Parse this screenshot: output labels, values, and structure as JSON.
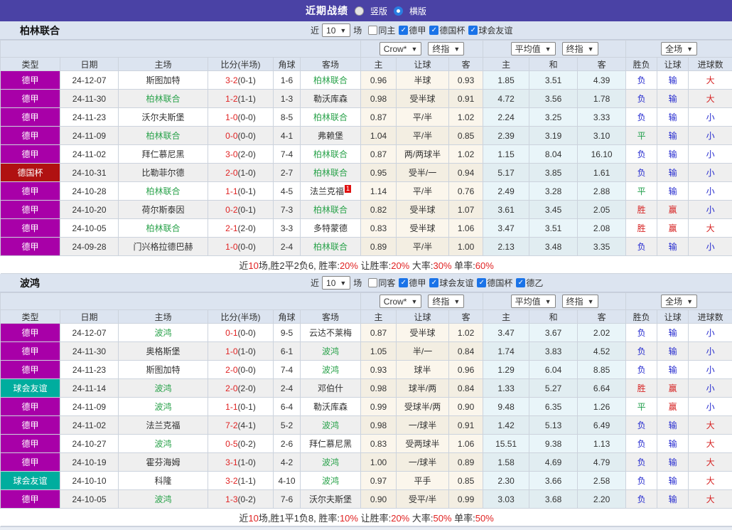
{
  "titlebar": {
    "title": "近期战绩",
    "radios": [
      {
        "label": "竖版",
        "checked": false
      },
      {
        "label": "横版",
        "checked": true
      }
    ]
  },
  "colors": {
    "titlebar_bg": "#4a42a5",
    "section_bg": "#dce4f0",
    "league": {
      "德甲": "#a800a8",
      "德国杯": "#b01111",
      "球会友谊": "#00ad9e",
      "德乙": "#a800a8"
    },
    "text": {
      "r": "#d62222",
      "b": "#2429cf",
      "g": "#1f9e4a",
      "d": "#333333"
    },
    "score_red": "#e02222",
    "team_green": "#2ba34c",
    "crow_col_bg": "#fbf6ec",
    "avg_col_bg": "#e9f5f9"
  },
  "columns": [
    "类型",
    "日期",
    "主场",
    "比分(半场)",
    "角球",
    "客场",
    "主",
    "让球",
    "客",
    "主",
    "和",
    "客",
    "胜负",
    "让球",
    "进球数"
  ],
  "sections": [
    {
      "team": "柏林联合",
      "filter": {
        "near": "近",
        "count": "10",
        "games": "场",
        "checks": [
          {
            "label": "同主",
            "checked": false
          },
          {
            "label": "德甲",
            "checked": true
          },
          {
            "label": "德国杯",
            "checked": true
          },
          {
            "label": "球会友谊",
            "checked": true
          }
        ]
      },
      "dropdowns": {
        "odds": "Crow*",
        "oddsTime": "终指",
        "avg": "平均值",
        "avgTime": "终指",
        "scope": "全场"
      },
      "rows": [
        {
          "league": "德甲",
          "date": "24-12-07",
          "home": "斯图加特",
          "homeG": false,
          "score": "3-2",
          "half": "(0-1)",
          "corner": "1-6",
          "away": "柏林联合",
          "awayG": true,
          "badge": "",
          "crowHome": "0.96",
          "handicap": "半球",
          "crowAway": "0.93",
          "avgHome": "1.85",
          "avgDraw": "3.51",
          "avgAway": "4.39",
          "result": "负",
          "resultC": "b",
          "letBall": "输",
          "letC": "b",
          "goals": "大",
          "goalsC": "r"
        },
        {
          "league": "德甲",
          "date": "24-11-30",
          "home": "柏林联合",
          "homeG": true,
          "score": "1-2",
          "half": "(1-1)",
          "corner": "1-3",
          "away": "勒沃库森",
          "awayG": false,
          "badge": "",
          "crowHome": "0.98",
          "handicap": "受半球",
          "crowAway": "0.91",
          "avgHome": "4.72",
          "avgDraw": "3.56",
          "avgAway": "1.78",
          "result": "负",
          "resultC": "b",
          "letBall": "输",
          "letC": "b",
          "goals": "大",
          "goalsC": "r"
        },
        {
          "league": "德甲",
          "date": "24-11-23",
          "home": "沃尔夫斯堡",
          "homeG": false,
          "score": "1-0",
          "half": "(0-0)",
          "corner": "8-5",
          "away": "柏林联合",
          "awayG": true,
          "badge": "",
          "crowHome": "0.87",
          "handicap": "平/半",
          "crowAway": "1.02",
          "avgHome": "2.24",
          "avgDraw": "3.25",
          "avgAway": "3.33",
          "result": "负",
          "resultC": "b",
          "letBall": "输",
          "letC": "b",
          "goals": "小",
          "goalsC": "b"
        },
        {
          "league": "德甲",
          "date": "24-11-09",
          "home": "柏林联合",
          "homeG": true,
          "score": "0-0",
          "half": "(0-0)",
          "corner": "4-1",
          "away": "弗赖堡",
          "awayG": false,
          "badge": "",
          "crowHome": "1.04",
          "handicap": "平/半",
          "crowAway": "0.85",
          "avgHome": "2.39",
          "avgDraw": "3.19",
          "avgAway": "3.10",
          "result": "平",
          "resultC": "g",
          "letBall": "输",
          "letC": "b",
          "goals": "小",
          "goalsC": "b"
        },
        {
          "league": "德甲",
          "date": "24-11-02",
          "home": "拜仁慕尼黑",
          "homeG": false,
          "score": "3-0",
          "half": "(2-0)",
          "corner": "7-4",
          "away": "柏林联合",
          "awayG": true,
          "badge": "",
          "crowHome": "0.87",
          "handicap": "两/两球半",
          "crowAway": "1.02",
          "avgHome": "1.15",
          "avgDraw": "8.04",
          "avgAway": "16.10",
          "result": "负",
          "resultC": "b",
          "letBall": "输",
          "letC": "b",
          "goals": "小",
          "goalsC": "b"
        },
        {
          "league": "德国杯",
          "date": "24-10-31",
          "home": "比勒菲尔德",
          "homeG": false,
          "score": "2-0",
          "half": "(1-0)",
          "corner": "2-7",
          "away": "柏林联合",
          "awayG": true,
          "badge": "",
          "crowHome": "0.95",
          "handicap": "受半/一",
          "crowAway": "0.94",
          "avgHome": "5.17",
          "avgDraw": "3.85",
          "avgAway": "1.61",
          "result": "负",
          "resultC": "b",
          "letBall": "输",
          "letC": "b",
          "goals": "小",
          "goalsC": "b"
        },
        {
          "league": "德甲",
          "date": "24-10-28",
          "home": "柏林联合",
          "homeG": true,
          "score": "1-1",
          "half": "(0-1)",
          "corner": "4-5",
          "away": "法兰克福",
          "awayG": false,
          "badge": "1",
          "crowHome": "1.14",
          "handicap": "平/半",
          "crowAway": "0.76",
          "avgHome": "2.49",
          "avgDraw": "3.28",
          "avgAway": "2.88",
          "result": "平",
          "resultC": "g",
          "letBall": "输",
          "letC": "b",
          "goals": "小",
          "goalsC": "b"
        },
        {
          "league": "德甲",
          "date": "24-10-20",
          "home": "荷尔斯泰因",
          "homeG": false,
          "score": "0-2",
          "half": "(0-1)",
          "corner": "7-3",
          "away": "柏林联合",
          "awayG": true,
          "badge": "",
          "crowHome": "0.82",
          "handicap": "受半球",
          "crowAway": "1.07",
          "avgHome": "3.61",
          "avgDraw": "3.45",
          "avgAway": "2.05",
          "result": "胜",
          "resultC": "r",
          "letBall": "赢",
          "letC": "r",
          "goals": "小",
          "goalsC": "b"
        },
        {
          "league": "德甲",
          "date": "24-10-05",
          "home": "柏林联合",
          "homeG": true,
          "score": "2-1",
          "half": "(2-0)",
          "corner": "3-3",
          "away": "多特蒙德",
          "awayG": false,
          "badge": "",
          "crowHome": "0.83",
          "handicap": "受半球",
          "crowAway": "1.06",
          "avgHome": "3.47",
          "avgDraw": "3.51",
          "avgAway": "2.08",
          "result": "胜",
          "resultC": "r",
          "letBall": "赢",
          "letC": "r",
          "goals": "大",
          "goalsC": "r"
        },
        {
          "league": "德甲",
          "date": "24-09-28",
          "home": "门兴格拉德巴赫",
          "homeG": false,
          "score": "1-0",
          "half": "(0-0)",
          "corner": "2-4",
          "away": "柏林联合",
          "awayG": true,
          "badge": "",
          "crowHome": "0.89",
          "handicap": "平/半",
          "crowAway": "1.00",
          "avgHome": "2.13",
          "avgDraw": "3.48",
          "avgAway": "3.35",
          "result": "负",
          "resultC": "b",
          "letBall": "输",
          "letC": "b",
          "goals": "小",
          "goalsC": "b"
        }
      ],
      "summary": [
        {
          "t": "近",
          "c": "d"
        },
        {
          "t": "10",
          "c": "r"
        },
        {
          "t": "场,胜2平2负6, 胜率:",
          "c": "d"
        },
        {
          "t": "20%",
          "c": "r"
        },
        {
          "t": " 让胜率:",
          "c": "d"
        },
        {
          "t": "20%",
          "c": "r"
        },
        {
          "t": " 大率:",
          "c": "d"
        },
        {
          "t": "30%",
          "c": "r"
        },
        {
          "t": " 单率:",
          "c": "d"
        },
        {
          "t": "60%",
          "c": "r"
        }
      ]
    },
    {
      "team": "波鸿",
      "filter": {
        "near": "近",
        "count": "10",
        "games": "场",
        "checks": [
          {
            "label": "同客",
            "checked": false
          },
          {
            "label": "德甲",
            "checked": true
          },
          {
            "label": "球会友谊",
            "checked": true
          },
          {
            "label": "德国杯",
            "checked": true
          },
          {
            "label": "德乙",
            "checked": true
          }
        ]
      },
      "dropdowns": {
        "odds": "Crow*",
        "oddsTime": "终指",
        "avg": "平均值",
        "avgTime": "终指",
        "scope": "全场"
      },
      "rows": [
        {
          "league": "德甲",
          "date": "24-12-07",
          "home": "波鸿",
          "homeG": true,
          "score": "0-1",
          "half": "(0-0)",
          "corner": "9-5",
          "away": "云达不莱梅",
          "awayG": false,
          "badge": "",
          "crowHome": "0.87",
          "handicap": "受半球",
          "crowAway": "1.02",
          "avgHome": "3.47",
          "avgDraw": "3.67",
          "avgAway": "2.02",
          "result": "负",
          "resultC": "b",
          "letBall": "输",
          "letC": "b",
          "goals": "小",
          "goalsC": "b"
        },
        {
          "league": "德甲",
          "date": "24-11-30",
          "home": "奥格斯堡",
          "homeG": false,
          "score": "1-0",
          "half": "(1-0)",
          "corner": "6-1",
          "away": "波鸿",
          "awayG": true,
          "badge": "",
          "crowHome": "1.05",
          "handicap": "半/一",
          "crowAway": "0.84",
          "avgHome": "1.74",
          "avgDraw": "3.83",
          "avgAway": "4.52",
          "result": "负",
          "resultC": "b",
          "letBall": "输",
          "letC": "b",
          "goals": "小",
          "goalsC": "b"
        },
        {
          "league": "德甲",
          "date": "24-11-23",
          "home": "斯图加特",
          "homeG": false,
          "score": "2-0",
          "half": "(0-0)",
          "corner": "7-4",
          "away": "波鸿",
          "awayG": true,
          "badge": "",
          "crowHome": "0.93",
          "handicap": "球半",
          "crowAway": "0.96",
          "avgHome": "1.29",
          "avgDraw": "6.04",
          "avgAway": "8.85",
          "result": "负",
          "resultC": "b",
          "letBall": "输",
          "letC": "b",
          "goals": "小",
          "goalsC": "b"
        },
        {
          "league": "球会友谊",
          "date": "24-11-14",
          "home": "波鸿",
          "homeG": true,
          "score": "2-0",
          "half": "(2-0)",
          "corner": "2-4",
          "away": "邓伯什",
          "awayG": false,
          "badge": "",
          "crowHome": "0.98",
          "handicap": "球半/两",
          "crowAway": "0.84",
          "avgHome": "1.33",
          "avgDraw": "5.27",
          "avgAway": "6.64",
          "result": "胜",
          "resultC": "r",
          "letBall": "赢",
          "letC": "r",
          "goals": "小",
          "goalsC": "b"
        },
        {
          "league": "德甲",
          "date": "24-11-09",
          "home": "波鸿",
          "homeG": true,
          "score": "1-1",
          "half": "(0-1)",
          "corner": "6-4",
          "away": "勒沃库森",
          "awayG": false,
          "badge": "",
          "crowHome": "0.99",
          "handicap": "受球半/两",
          "crowAway": "0.90",
          "avgHome": "9.48",
          "avgDraw": "6.35",
          "avgAway": "1.26",
          "result": "平",
          "resultC": "g",
          "letBall": "赢",
          "letC": "r",
          "goals": "小",
          "goalsC": "b"
        },
        {
          "league": "德甲",
          "date": "24-11-02",
          "home": "法兰克福",
          "homeG": false,
          "score": "7-2",
          "half": "(4-1)",
          "corner": "5-2",
          "away": "波鸿",
          "awayG": true,
          "badge": "",
          "crowHome": "0.98",
          "handicap": "一/球半",
          "crowAway": "0.91",
          "avgHome": "1.42",
          "avgDraw": "5.13",
          "avgAway": "6.49",
          "result": "负",
          "resultC": "b",
          "letBall": "输",
          "letC": "b",
          "goals": "大",
          "goalsC": "r"
        },
        {
          "league": "德甲",
          "date": "24-10-27",
          "home": "波鸿",
          "homeG": true,
          "score": "0-5",
          "half": "(0-2)",
          "corner": "2-6",
          "away": "拜仁慕尼黑",
          "awayG": false,
          "badge": "",
          "crowHome": "0.83",
          "handicap": "受两球半",
          "crowAway": "1.06",
          "avgHome": "15.51",
          "avgDraw": "9.38",
          "avgAway": "1.13",
          "result": "负",
          "resultC": "b",
          "letBall": "输",
          "letC": "b",
          "goals": "大",
          "goalsC": "r"
        },
        {
          "league": "德甲",
          "date": "24-10-19",
          "home": "霍芬海姆",
          "homeG": false,
          "score": "3-1",
          "half": "(1-0)",
          "corner": "4-2",
          "away": "波鸿",
          "awayG": true,
          "badge": "",
          "crowHome": "1.00",
          "handicap": "一/球半",
          "crowAway": "0.89",
          "avgHome": "1.58",
          "avgDraw": "4.69",
          "avgAway": "4.79",
          "result": "负",
          "resultC": "b",
          "letBall": "输",
          "letC": "b",
          "goals": "大",
          "goalsC": "r"
        },
        {
          "league": "球会友谊",
          "date": "24-10-10",
          "home": "科隆",
          "homeG": false,
          "score": "3-2",
          "half": "(1-1)",
          "corner": "4-10",
          "away": "波鸿",
          "awayG": true,
          "badge": "",
          "crowHome": "0.97",
          "handicap": "平手",
          "crowAway": "0.85",
          "avgHome": "2.30",
          "avgDraw": "3.66",
          "avgAway": "2.58",
          "result": "负",
          "resultC": "b",
          "letBall": "输",
          "letC": "b",
          "goals": "大",
          "goalsC": "r"
        },
        {
          "league": "德甲",
          "date": "24-10-05",
          "home": "波鸿",
          "homeG": true,
          "score": "1-3",
          "half": "(0-2)",
          "corner": "7-6",
          "away": "沃尔夫斯堡",
          "awayG": false,
          "badge": "",
          "crowHome": "0.90",
          "handicap": "受平/半",
          "crowAway": "0.99",
          "avgHome": "3.03",
          "avgDraw": "3.68",
          "avgAway": "2.20",
          "result": "负",
          "resultC": "b",
          "letBall": "输",
          "letC": "b",
          "goals": "大",
          "goalsC": "r"
        }
      ],
      "summary": [
        {
          "t": "近",
          "c": "d"
        },
        {
          "t": "10",
          "c": "r"
        },
        {
          "t": "场,胜1平1负8, 胜率:",
          "c": "d"
        },
        {
          "t": "10%",
          "c": "r"
        },
        {
          "t": " 让胜率:",
          "c": "d"
        },
        {
          "t": "20%",
          "c": "r"
        },
        {
          "t": " 大率:",
          "c": "d"
        },
        {
          "t": "50%",
          "c": "r"
        },
        {
          "t": " 单率:",
          "c": "d"
        },
        {
          "t": "50%",
          "c": "r"
        }
      ]
    }
  ]
}
